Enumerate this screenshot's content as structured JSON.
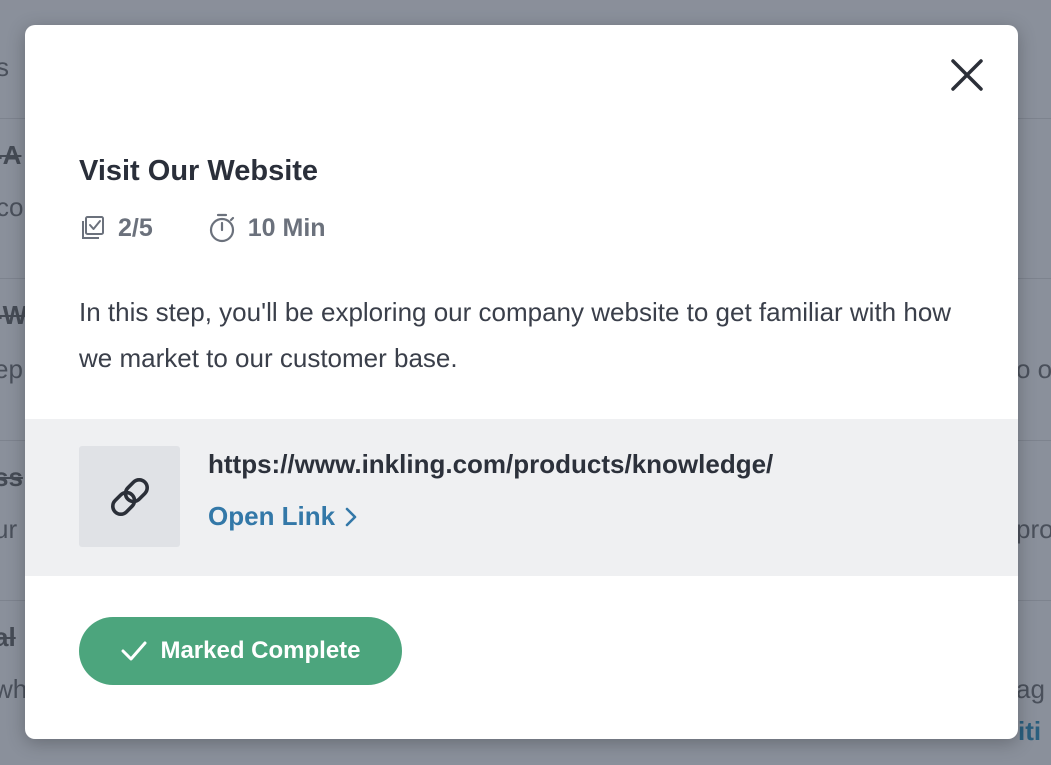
{
  "background": {
    "fragments": [
      "s",
      "-A",
      "co",
      "-W",
      "ep.",
      "o o",
      "ss",
      "ur",
      "pro",
      "al",
      "wh",
      "ag",
      "iti"
    ]
  },
  "modal": {
    "close_icon": "close-icon",
    "title": "Visit Our Website",
    "progress": "2/5",
    "progress_icon": "checklist-icon",
    "duration": "10 Min",
    "duration_icon": "stopwatch-icon",
    "description": "In this step, you'll be exploring our company website to get familiar with how we market to our customer base.",
    "link": {
      "icon": "link-icon",
      "url": "https://www.inkling.com/products/knowledge/",
      "open_label": "Open Link",
      "open_icon": "chevron-right-icon"
    },
    "complete_button": {
      "label": "Marked Complete",
      "icon": "checkmark-icon"
    }
  },
  "colors": {
    "accent_green": "#4ca57d",
    "link_blue": "#3378a8",
    "overlay": "#8a909b"
  }
}
